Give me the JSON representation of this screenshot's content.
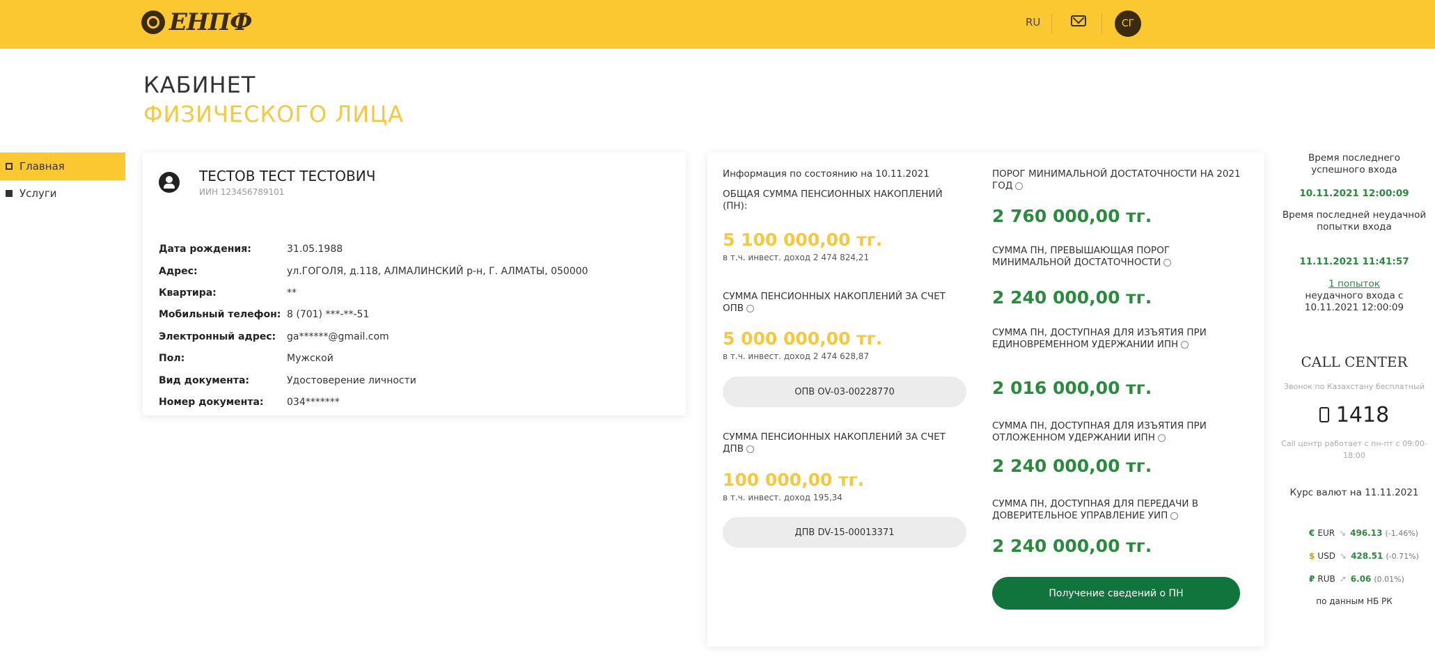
{
  "header": {
    "logo_text": "ЕНПФ",
    "language": "RU",
    "avatar_initials": "СГ",
    "background_color": "#fcc832"
  },
  "title": {
    "line1": "КАБИНЕТ",
    "line2": "ФИЗИЧЕСКОГО ЛИЦА"
  },
  "sidebar": {
    "items": [
      {
        "label": "Главная",
        "active": true
      },
      {
        "label": "Услуги",
        "active": false
      }
    ]
  },
  "profile": {
    "name": "ТЕСТОВ ТЕСТ ТЕСТОВИЧ",
    "iin": "ИИН 123456789101",
    "rows": [
      {
        "label": "Дата рождения:",
        "value": "31.05.1988"
      },
      {
        "label": "Адрес:",
        "value": "ул.ГОГОЛЯ, д.118, АЛМАЛИНСКИЙ р-н, Г. АЛМАТЫ, 050000"
      },
      {
        "label": "Квартира:",
        "value": "**"
      },
      {
        "label": "Мобильный телефон:",
        "value": "8 (701) ***-**-51"
      },
      {
        "label": "Электронный адрес:",
        "value": "ga******@gmail.com"
      },
      {
        "label": "Пол:",
        "value": "Мужской"
      },
      {
        "label": "Вид документа:",
        "value": "Удостоверение личности"
      },
      {
        "label": "Номер документа:",
        "value": "034*******"
      }
    ]
  },
  "savings": {
    "info_date": "Информация по состоянию на 10.11.2021",
    "total": {
      "label": "ОБЩАЯ СУММА ПЕНСИОННЫХ НАКОПЛЕНИЙ (ПН):",
      "amount": "5 100 000,00 тг.",
      "income": "в т.ч. инвест. доход 2 474 824,21"
    },
    "opv": {
      "label": "СУММА ПЕНСИОННЫХ НАКОПЛЕНИЙ ЗА СЧЕТ ОПВ",
      "amount": "5 000 000,00 тг.",
      "income": "в т.ч. инвест. доход 2 474 628,87",
      "button": "ОПВ ОV-03-00228770"
    },
    "dpv": {
      "label": "СУММА ПЕНСИОННЫХ НАКОПЛЕНИЙ ЗА СЧЕТ ДПВ",
      "amount": "100 000,00 тг.",
      "income": "в т.ч. инвест. доход 195,34",
      "button": "ДПВ DV-15-00013371"
    },
    "threshold": {
      "label": "ПОРОГ МИНИМАЛЬНОЙ ДОСТАТОЧНОСТИ НА 2021 ГОД",
      "amount": "2 760 000,00 тг."
    },
    "over_threshold": {
      "label": "СУММА ПН, ПРЕВЫШАЮЩАЯ ПОРОГ МИНИМАЛЬНОЙ ДОСТАТОЧНОСТИ",
      "amount": "2 240 000,00 тг."
    },
    "withdraw_once": {
      "label": "СУММА ПН, ДОСТУПНАЯ ДЛЯ ИЗЪЯТИЯ ПРИ ЕДИНОВРЕМЕННОМ УДЕРЖАНИИ ИПН",
      "amount": "2 016 000,00 тг."
    },
    "withdraw_deferred": {
      "label": "СУММА ПН, ДОСТУПНАЯ ДЛЯ ИЗЪЯТИЯ ПРИ ОТЛОЖЕННОМ УДЕРЖАНИИ ИПН",
      "amount": "2 240 000,00 тг."
    },
    "trust": {
      "label": "СУММА ПН, ДОСТУПНАЯ ДЛЯ ПЕРЕДАЧИ В ДОВЕРИТЕЛЬНОЕ УПРАВЛЕНИЕ УИП",
      "amount": "2 240 000,00 тг."
    },
    "action_button": "Получение сведений о ПН"
  },
  "right_panel": {
    "last_login_label": "Время последнего успешного входа",
    "last_login_value": "10.11.2021 12:00:09",
    "last_fail_label": "Время последней неудачной попытки входа",
    "last_fail_value": "11.11.2021 11:41:57",
    "attempts_link": "1 попыток",
    "attempts_text": "неудачного входа с 10.11.2021 12:00:09",
    "call_center_title": "CALL CENTER",
    "call_center_sub": "Звонок по Казахстану бесплатный",
    "phone": "1418",
    "call_center_hours": "Call центр работает с пн-пт с 09:00-18:00",
    "rates_title": "Курс валют на 11.11.2021",
    "rates": [
      {
        "symbol": "€",
        "code": "EUR",
        "value": "496.13",
        "change": "(-1.46%)"
      },
      {
        "symbol": "$",
        "code": "USD",
        "value": "428.51",
        "change": "(-0.71%)"
      },
      {
        "symbol": "₽",
        "code": "RUB",
        "value": "6.06",
        "change": "(0.01%)"
      }
    ],
    "rates_source": "по данным НБ РК"
  }
}
